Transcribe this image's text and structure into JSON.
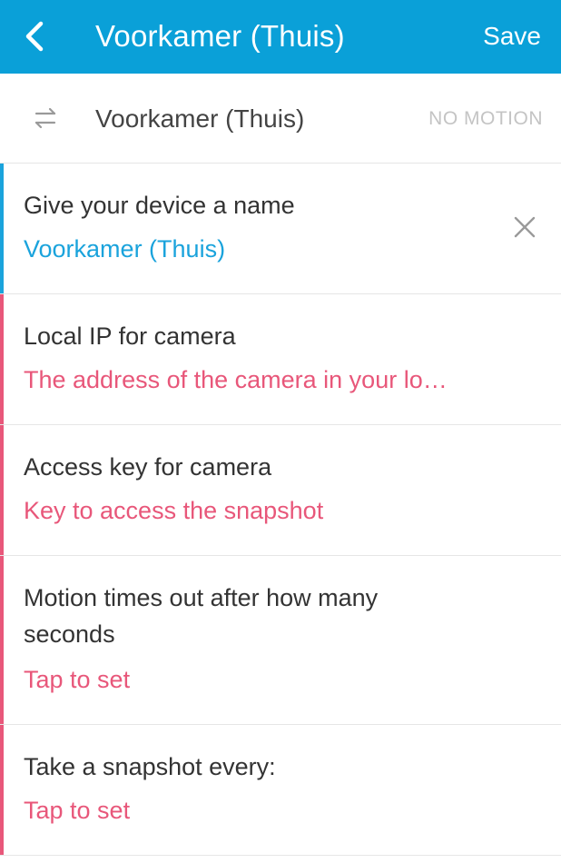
{
  "appbar": {
    "title": "Voorkamer (Thuis)",
    "save_label": "Save",
    "color": "#0aa0d8"
  },
  "status": {
    "device_name": "Voorkamer (Thuis)",
    "state": "NO MOTION"
  },
  "fields": [
    {
      "label": "Give your device a name",
      "value": "Voorkamer (Thuis)",
      "accent": "#1aa3dc"
    },
    {
      "label": "Local IP for camera",
      "value": "The address of the camera in your lo…",
      "accent": "#e8577a"
    },
    {
      "label": "Access key for camera",
      "value": "Key to access the snapshot",
      "accent": "#e8577a"
    },
    {
      "label": "Motion times out after how many seconds",
      "value": "Tap to set",
      "accent": "#e8577a"
    },
    {
      "label": "Take a snapshot every:",
      "value": "Tap to set",
      "accent": "#e8577a"
    }
  ]
}
